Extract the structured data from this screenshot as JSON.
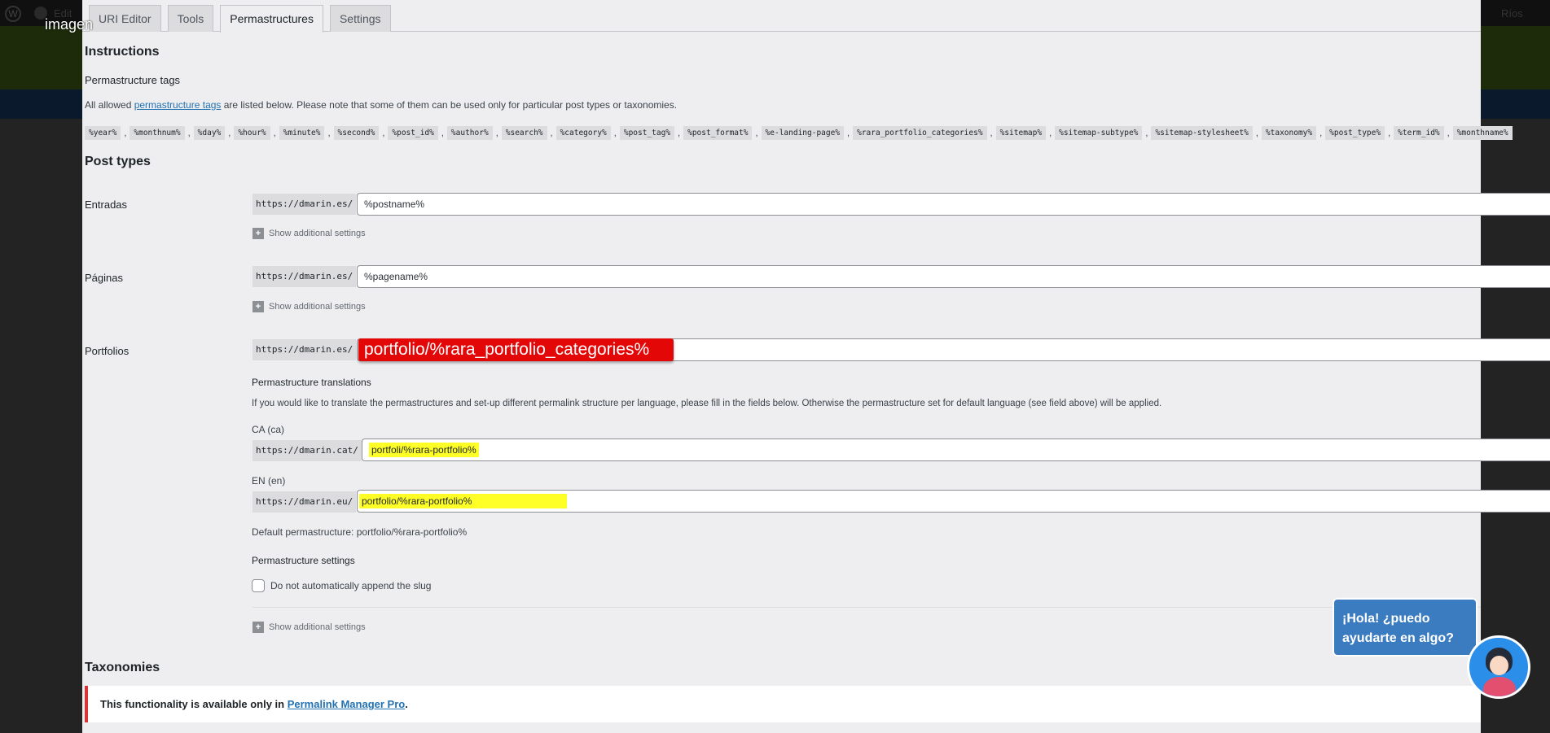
{
  "overlay": {
    "image_label": "imagen"
  },
  "wp_bar": {
    "left_text": "Edit",
    "right_text": "Ríos"
  },
  "tabs": [
    {
      "label": "URI Editor"
    },
    {
      "label": "Tools"
    },
    {
      "label": "Permastructures"
    },
    {
      "label": "Settings"
    }
  ],
  "instructions": {
    "title": "Instructions",
    "subtitle": "Permastructure tags",
    "text_before": "All allowed ",
    "link": "permastructure tags",
    "text_after": " are listed below. Please note that some of them can be used only for particular post types or taxonomies.",
    "tags": [
      "%year%",
      "%monthnum%",
      "%day%",
      "%hour%",
      "%minute%",
      "%second%",
      "%post_id%",
      "%author%",
      "%search%",
      "%category%",
      "%post_tag%",
      "%post_format%",
      "%e-landing-page%",
      "%rara_portfolio_categories%",
      "%sitemap%",
      "%sitemap-subtype%",
      "%sitemap-stylesheet%",
      "%taxonomy%",
      "%post_type%",
      "%term_id%",
      "%monthname%"
    ]
  },
  "post_types": {
    "title": "Post types",
    "show_additional": "Show additional settings",
    "rows": [
      {
        "label": "Entradas",
        "prefix": "https://dmarin.es/",
        "value": "%postname%"
      },
      {
        "label": "Páginas",
        "prefix": "https://dmarin.es/",
        "value": "%pagename%"
      },
      {
        "label": "Portfolios",
        "prefix": "https://dmarin.es/",
        "value": "portfolio/%rara_portfolio_categories%"
      }
    ]
  },
  "translations": {
    "title": "Permastructure translations",
    "description": "If you would like to translate the permastructures and set-up different permalink structure per language, please fill in the fields below. Otherwise the permastructure set for default language (see field above) will be applied.",
    "langs": [
      {
        "label": "CA (ca)",
        "prefix": "https://dmarin.cat/",
        "value": "portfoli/%rara-portfolio%"
      },
      {
        "label": "EN (en)",
        "prefix": "https://dmarin.eu/",
        "value": "portfolio/%rara-portfolio%"
      }
    ],
    "default_label": "Default permastructure:",
    "default_value": "portfolio/%rara-portfolio%"
  },
  "settings": {
    "title": "Permastructure settings",
    "checkbox_label": "Do not automatically append the slug"
  },
  "taxonomies": {
    "title": "Taxonomies",
    "notice_text": "This functionality is available only in ",
    "notice_link": "Permalink Manager Pro",
    "notice_end": "."
  },
  "chat": {
    "line1": "¡Hola! ¿puedo",
    "line2": "ayudarte en algo?"
  },
  "colors": {
    "highlight_red": "#e40707",
    "highlight_yellow": "#ffff28",
    "link": "#2271b1",
    "chat": "#3b7bbf"
  }
}
